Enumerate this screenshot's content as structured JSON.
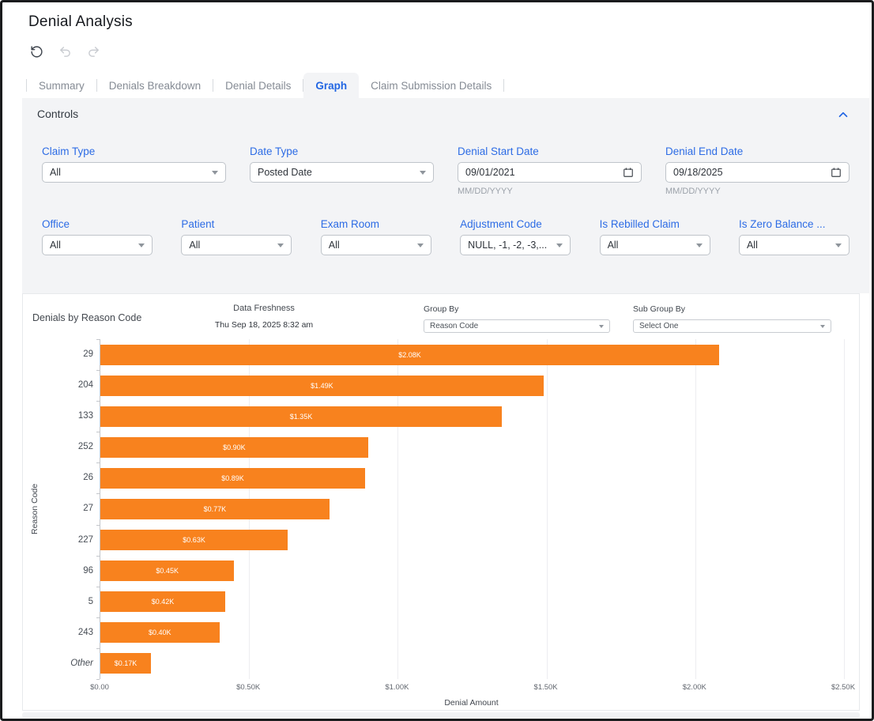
{
  "window": {
    "title": "Denial Analysis"
  },
  "colors": {
    "accent_blue": "#2266e3",
    "bar_orange": "#f8821e",
    "panel_gray": "#f3f4f6"
  },
  "toolbar": {
    "icons": [
      {
        "name": "refresh-icon",
        "enabled": true
      },
      {
        "name": "undo-icon",
        "enabled": false
      },
      {
        "name": "redo-icon",
        "enabled": false
      }
    ]
  },
  "tabs": [
    {
      "label": "Summary",
      "active": false
    },
    {
      "label": "Denials Breakdown",
      "active": false
    },
    {
      "label": "Denial Details",
      "active": false
    },
    {
      "label": "Graph",
      "active": true
    },
    {
      "label": "Claim Submission Details",
      "active": false
    }
  ],
  "controls": {
    "title": "Controls",
    "collapse_icon": "chevron-up-icon",
    "row1": [
      {
        "label": "Claim Type",
        "type": "select",
        "value": "All"
      },
      {
        "label": "Date Type",
        "type": "select",
        "value": "Posted Date"
      },
      {
        "label": "Denial Start Date",
        "type": "date",
        "value": "09/01/2021",
        "hint": "MM/DD/YYYY"
      },
      {
        "label": "Denial End Date",
        "type": "date",
        "value": "09/18/2025",
        "hint": "MM/DD/YYYY"
      }
    ],
    "row2": [
      {
        "label": "Office",
        "type": "select",
        "value": "All"
      },
      {
        "label": "Patient",
        "type": "select",
        "value": "All"
      },
      {
        "label": "Exam Room",
        "type": "select",
        "value": "All"
      },
      {
        "label": "Adjustment Code",
        "type": "select",
        "value": "NULL, -1, -2, -3,..."
      },
      {
        "label": "Is Rebilled Claim",
        "type": "select",
        "value": "All"
      },
      {
        "label": "Is Zero Balance ...",
        "type": "select",
        "value": "All"
      }
    ]
  },
  "chart_header": {
    "title": "Denials by Reason Code",
    "data_freshness_label": "Data Freshness",
    "data_freshness_value": "Thu Sep 18, 2025 8:32 am",
    "group_by_label": "Group By",
    "group_by_value": "Reason Code",
    "sub_group_by_label": "Sub Group By",
    "sub_group_by_value": "Select One"
  },
  "chart_data": {
    "type": "bar",
    "orientation": "horizontal",
    "title": "Denials by Reason Code",
    "categories": [
      "29",
      "204",
      "133",
      "252",
      "26",
      "27",
      "227",
      "96",
      "5",
      "243",
      "Other"
    ],
    "values": [
      2.08,
      1.49,
      1.35,
      0.9,
      0.89,
      0.77,
      0.63,
      0.45,
      0.42,
      0.4,
      0.17
    ],
    "unit": "USD thousands",
    "bar_labels": [
      "$2.08K",
      "$1.49K",
      "$1.35K",
      "$0.90K",
      "$0.89K",
      "$0.77K",
      "$0.63K",
      "$0.45K",
      "$0.42K",
      "$0.40K",
      "$0.17K"
    ],
    "xlabel": "Denial Amount",
    "ylabel": "Reason Code",
    "xlim": [
      0,
      2.5
    ],
    "x_ticks": [
      "$0.00",
      "$0.50K",
      "$1.00K",
      "$1.50K",
      "$2.00K",
      "$2.50K"
    ],
    "bar_color": "#f8821e",
    "grid": true,
    "legend": "none"
  }
}
